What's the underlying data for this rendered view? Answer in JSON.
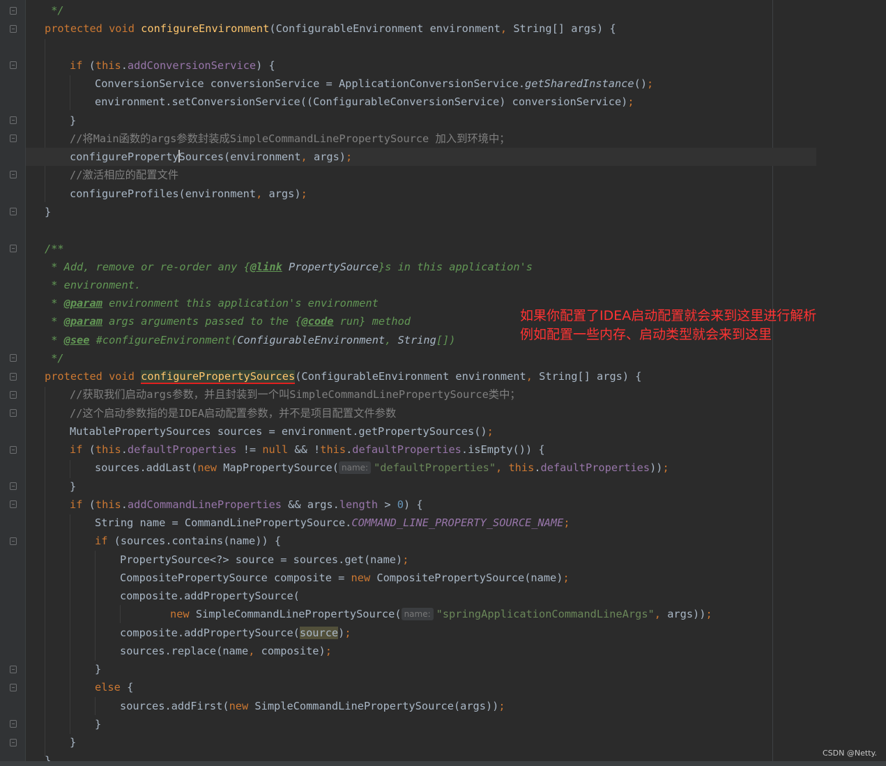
{
  "annotation": {
    "line1": "如果你配置了IDEA启动配置就会来到这里进行解析",
    "line2": "例如配置一些内存、启动类型就会来到这里"
  },
  "watermark": "CSDN @Netty.",
  "hints": {
    "name": "name:"
  },
  "colors": {
    "background": "#2b2b2b",
    "keyword": "#cc7832",
    "method": "#ffc66d",
    "field": "#9876aa",
    "string": "#6a8759",
    "comment": "#808080",
    "javadoc": "#629755",
    "annotation_text": "#ff3333"
  },
  "code": {
    "l01": {
      "a": " */"
    },
    "l02": {
      "kw": "protected void ",
      "fn": "configureEnvironment",
      "b": "(ConfigurableEnvironment environment",
      "sep": ", ",
      "c": "String[] args) {"
    },
    "l04": {
      "kw": "if ",
      "p": "(",
      "this": "this",
      "dot": ".",
      "fd": "addConversionService",
      "e": ") {"
    },
    "l05": {
      "a": "ConversionService conversionService = ApplicationConversionService.",
      "it": "getSharedInstance",
      "b": "()",
      "semi": ";"
    },
    "l06": {
      "a": "environment.setConversionService((ConfigurableConversionService) conversionService)",
      "semi": ";"
    },
    "l07": {
      "a": "}"
    },
    "l08": {
      "cm": "//将Main函数的args参数封装成SimpleCommandLinePropertySource 加入到环境中；"
    },
    "l09": {
      "a1": "configureProperty",
      "a2": "Sources",
      "b": "(environment",
      "sep": ", ",
      "c": "args)",
      "semi": ";"
    },
    "l10": {
      "cm": "//激活相应的配置文件"
    },
    "l11": {
      "a": "configureProfiles(environment",
      "sep": ", ",
      "c": "args)",
      "semi": ";"
    },
    "l12": {
      "a": "}"
    },
    "l14": {
      "doc": "/**"
    },
    "l15": {
      "d1": " * Add, remove or re-order any {",
      "tag": "@link",
      "ref": " PropertySource",
      "d2": "}s in this application's"
    },
    "l16": {
      "d1": " * environment."
    },
    "l17": {
      "d1": " * ",
      "tag": "@param",
      "d2": " environment this application's environment"
    },
    "l18": {
      "d1": " * ",
      "tag": "@param",
      "d2": " args arguments passed to the {",
      "tag2": "@code",
      "d3": " run} method"
    },
    "l19": {
      "d1": " * ",
      "tag": "@see",
      "d2": " #configureEnvironment(",
      "ref": "ConfigurableEnvironment",
      "d3": ", ",
      "ref2": "String",
      "d4": "[])"
    },
    "l20": {
      "doc": " */"
    },
    "l21": {
      "kw": "protected void ",
      "fn": "configurePropertySources",
      "b": "(ConfigurableEnvironment environment",
      "sep": ", ",
      "c": "String[] args) {"
    },
    "l22": {
      "cm": "//获取我们启动args参数，并且封装到一个叫SimpleCommandLinePropertySource类中；"
    },
    "l23": {
      "cm": "//这个启动参数指的是IDEA启动配置参数，并不是项目配置文件参数"
    },
    "l24": {
      "a": "MutablePropertySources sources = environment.getPropertySources()",
      "semi": ";"
    },
    "l25": {
      "kw": "if ",
      "p": "(",
      "this": "this",
      "dot": ".",
      "fd": "defaultProperties",
      "b": " != ",
      "nul": "null",
      "c": " && !",
      "this2": "this",
      "dot2": ".",
      "fd2": "defaultProperties",
      "d": ".isEmpty()) {"
    },
    "l26": {
      "a": "sources.addLast(",
      "kw": "new ",
      "b": "MapPropertySource(",
      "st": "\"defaultProperties\"",
      "sep": ", ",
      "this": "this",
      "dot": ".",
      "fd": "defaultProperties",
      "c": "))",
      "semi": ";"
    },
    "l27": {
      "a": "}"
    },
    "l28": {
      "kw": "if ",
      "p": "(",
      "this": "this",
      "dot": ".",
      "fd": "addCommandLineProperties",
      "b": " && args.",
      "fd2": "length",
      "c": " > ",
      "nu": "0",
      "d": ") {"
    },
    "l29": {
      "a": "String name = CommandLinePropertySource.",
      "sf": "COMMAND_LINE_PROPERTY_SOURCE_NAME",
      "semi": ";"
    },
    "l30": {
      "kw": "if ",
      "a": "(sources.contains(name)) {"
    },
    "l31": {
      "a": "PropertySource<?> source = sources.get(name)",
      "semi": ";"
    },
    "l32": {
      "a": "CompositePropertySource composite = ",
      "kw": "new ",
      "b": "CompositePropertySource(name)",
      "semi": ";"
    },
    "l33": {
      "a": "composite.addPropertySource("
    },
    "l34": {
      "kw": "new ",
      "a": "SimpleCommandLinePropertySource(",
      "st": "\"springApplicationCommandLineArgs\"",
      "sep": ", ",
      "b": "args))",
      "semi": ";"
    },
    "l35": {
      "a": "composite.addPropertySource(",
      "hl": "source",
      "b": ")",
      "semi": ";"
    },
    "l36": {
      "a": "sources.replace(name",
      "sep": ", ",
      "b": "composite)",
      "semi": ";"
    },
    "l37": {
      "a": "}"
    },
    "l38": {
      "kw": "else ",
      "a": "{"
    },
    "l39": {
      "a": "sources.addFirst(",
      "kw": "new ",
      "b": "SimpleCommandLinePropertySource(args))",
      "semi": ";"
    },
    "l40": {
      "a": "}"
    },
    "l41": {
      "a": "}"
    },
    "l42": {
      "a": "}"
    }
  }
}
